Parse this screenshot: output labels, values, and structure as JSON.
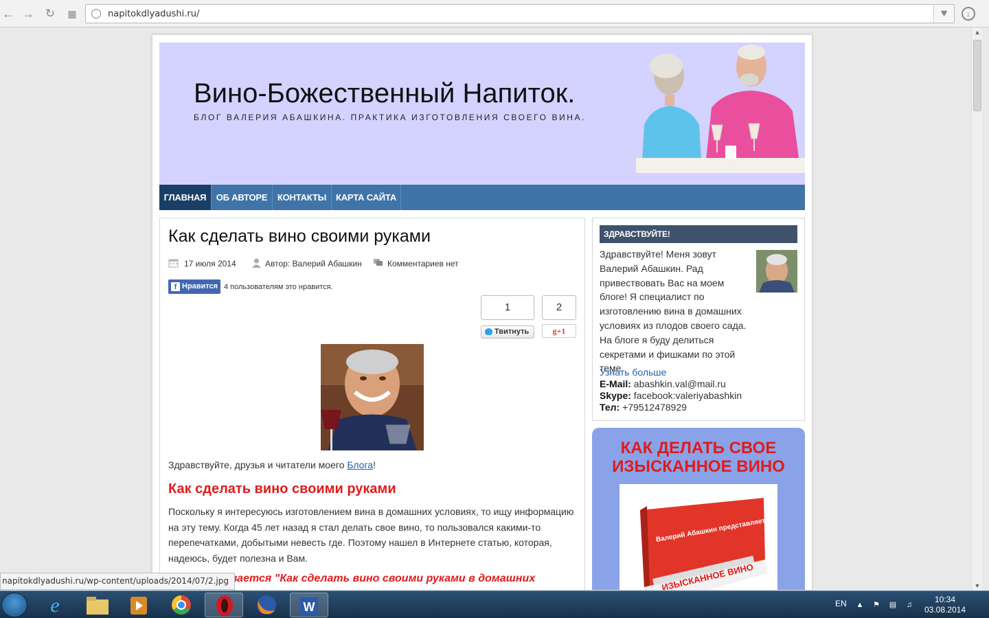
{
  "browser": {
    "url": "napitokdlyadushi.ru/"
  },
  "site": {
    "title": "Вино-Божественный Напиток.",
    "description": "БЛОГ ВАЛЕРИЯ АБАШКИНА. ПРАКТИКА ИЗГОТОВЛЕНИЯ СВОЕГО ВИНА."
  },
  "nav": {
    "items": [
      {
        "label": "ГЛАВНАЯ"
      },
      {
        "label": "ОБ АВТОРЕ"
      },
      {
        "label": "КОНТАКТЫ"
      },
      {
        "label": "КАРТА САЙТА"
      }
    ]
  },
  "post": {
    "title": "Как сделать вино своими руками",
    "date": "17 июля 2014",
    "author": "Автор: Валерий Абашкин",
    "comments": "Комментариев нет",
    "fb_like_label": "Нравится",
    "fb_text": "4 пользователям это нравится.",
    "tweet_count": "1",
    "tweet_label": "Твитнуть",
    "gplus_count": "2",
    "gplus_label": "g+1",
    "greeting_prefix": "Здравствуйте, друзья и читатели моего ",
    "greeting_link": "Блога",
    "greeting_suffix": "!",
    "heading": "Как сделать вино своими руками",
    "paragraph": "Поскольку я интересуюсь изготовлением вина в домашних условиях, то ищу информацию на эту тему. Когда 45 лет назад я стал делать свое вино, то пользовался какими-то перепечатками, добытыми невесть где. Поэтому нашел в Интернете статью, которая, надеюсь, будет полезна и Вам.",
    "italic_line": "азывается \"Как сделать вино своими руками в домашних"
  },
  "sidebar": {
    "widget_title": "ЗДРАВСТВУЙТЕ!",
    "widget_text": "Здравствуйте! Меня зовут Валерий Абашкин. Рад привествовать Вас на моем блоге! Я специалист по изготовлению вина в домашних условиях из плодов своего сада. На блоге я буду делиться секретами и фишками по этой теме.",
    "learn_more": "Узнать больше",
    "email_label": "E-Mail:",
    "email_value": " abashkin.val@mail.ru",
    "skype_label": "Skype:",
    "skype_value": " facebook:valeriyabashkin",
    "phone_label": "Тел:",
    "phone_value": " +79512478929",
    "ebook_title_1": "КАК ДЕЛАТЬ СВОЕ",
    "ebook_title_2": "ИЗЫСКАННОЕ ВИНО",
    "ebook_cover_top": "Валерий Абашкин представляет",
    "ebook_cover_main": "ИЗЫСКАННОЕ ВИНО",
    "ebook_cover_side": "ИЗЫСКАННОЕ"
  },
  "status_bar": {
    "link": "napitokdlyadushi.ru/wp-content/uploads/2014/07/2.jpg"
  },
  "taskbar": {
    "lang": "EN",
    "time": "10:34",
    "date": "03.08.2014"
  },
  "colors": {
    "header_bg": "#d4d2ff",
    "nav_bg": "#3f74a8",
    "nav_active": "#1a3f66",
    "accent_red": "#e01b1b",
    "link_blue": "#1f5fa8"
  }
}
